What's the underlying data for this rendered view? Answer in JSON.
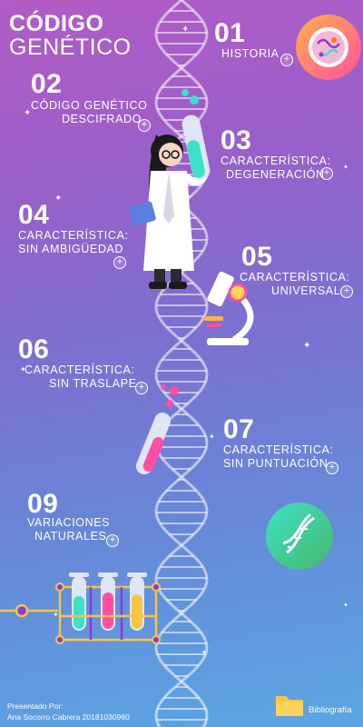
{
  "title": {
    "line1": "CÓDIGO",
    "line2": "GENÉTICO"
  },
  "sections": [
    {
      "num": "01",
      "line1": "HISTORIA",
      "line2": ""
    },
    {
      "num": "02",
      "line1": "CÓDIGO GENÉTICO",
      "line2": "DESCIFRADO"
    },
    {
      "num": "03",
      "line1": "CARACTERÍSTICA:",
      "line2": "DEGENERACIÓN"
    },
    {
      "num": "04",
      "line1": "CARACTERÍSTICA:",
      "line2": "SIN AMBIGÜEDAD"
    },
    {
      "num": "05",
      "line1": "CARACTERÍSTICA:",
      "line2": "UNIVERSAL"
    },
    {
      "num": "06",
      "line1": "CARACTERÍSTICA:",
      "line2": "SIN TRASLAPE"
    },
    {
      "num": "07",
      "line1": "CARACTERÍSTICA:",
      "line2": "SIN PUNTUACIÓN"
    },
    {
      "num": "09",
      "line1": "VARIACIONES",
      "line2": "NATURALES"
    }
  ],
  "expand_symbol": "+",
  "footer": {
    "presented_by": "Presentado Por:",
    "author": "Ana Socorro Cabrera 20181030960"
  },
  "bibliography": {
    "label": "Bibliografía"
  },
  "colors": {
    "bg_top": "#b25cc6",
    "bg_bottom": "#5aa7e3",
    "accent_yellow": "#f6c544",
    "accent_pink": "#ff4fa3",
    "accent_teal": "#3ee0c8",
    "purple": "#8b3bd6"
  },
  "icons": [
    "bacteria-badge-icon",
    "dna-badge-icon",
    "microscope-icon",
    "test-tube-icon",
    "test-tube-rack-icon",
    "folder-icon",
    "scientist-illustration",
    "dna-helix-background"
  ]
}
